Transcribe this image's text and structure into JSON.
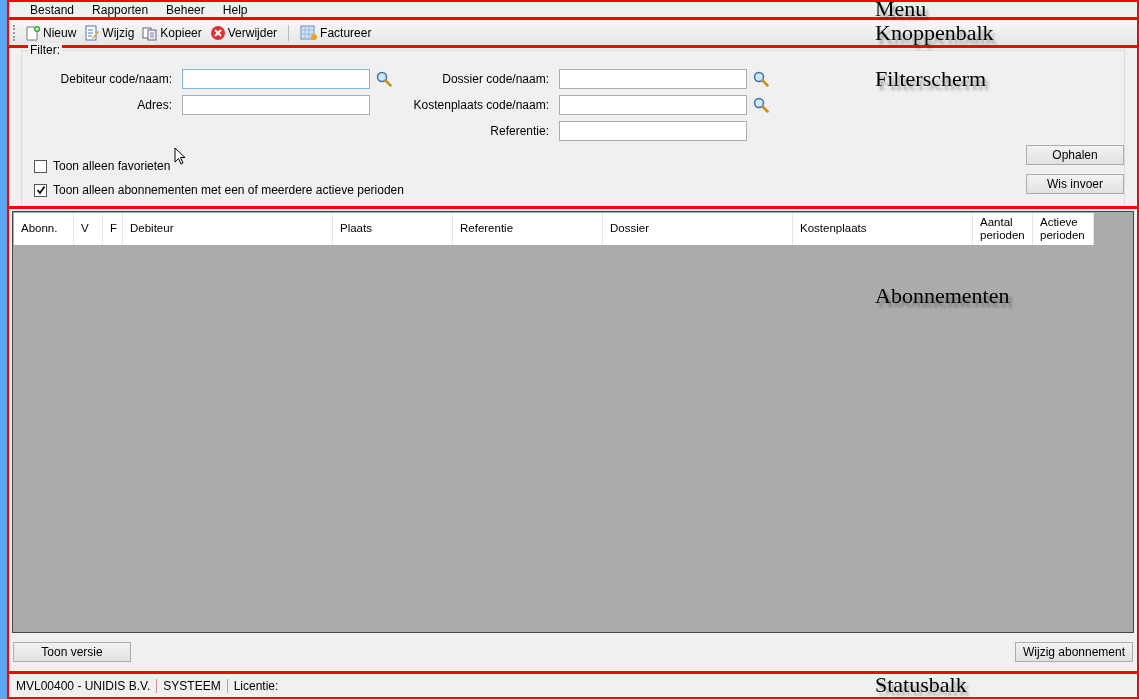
{
  "menu": {
    "items": [
      {
        "label": "Bestand"
      },
      {
        "label": "Rapporten"
      },
      {
        "label": "Beheer"
      },
      {
        "label": "Help"
      }
    ],
    "annotation": "Menu"
  },
  "toolbar": {
    "items": [
      {
        "label": "Nieuw",
        "kind": "new",
        "separator_before": false
      },
      {
        "label": "Wijzig",
        "kind": "edit",
        "separator_before": false
      },
      {
        "label": "Kopieer",
        "kind": "copy",
        "separator_before": false
      },
      {
        "label": "Verwijder",
        "kind": "delete",
        "separator_before": false
      },
      {
        "label": "Factureer",
        "kind": "invoice",
        "separator_before": true
      }
    ],
    "annotation": "Knoppenbalk"
  },
  "filter": {
    "title": "Filter:",
    "annotation": "Filterscherm",
    "left_fields": [
      {
        "label": "Debiteur code/naam:",
        "lookup": true,
        "focused": true
      },
      {
        "label": "Adres:",
        "lookup": false,
        "focused": false
      }
    ],
    "right_fields": [
      {
        "label": "Dossier code/naam:",
        "lookup": true,
        "focused": false
      },
      {
        "label": "Kostenplaats code/naam:",
        "lookup": true,
        "focused": false
      },
      {
        "label": "Referentie:",
        "lookup": false,
        "focused": false
      }
    ],
    "checkboxes": [
      {
        "label": "Toon alleen favorieten",
        "checked": false
      },
      {
        "label": "Toon alleen abonnementen met een of meerdere actieve perioden",
        "checked": true
      }
    ],
    "buttons": [
      "Ophalen",
      "Wis invoer"
    ]
  },
  "subscriptions": {
    "annotation": "Abonnementen",
    "columns": [
      {
        "label": "Abonn."
      },
      {
        "label": "V"
      },
      {
        "label": "F"
      },
      {
        "label": "Debiteur"
      },
      {
        "label": "Plaats"
      },
      {
        "label": "Referentie"
      },
      {
        "label": "Dossier"
      },
      {
        "label": "Kostenplaats"
      },
      {
        "label": "Aantal perioden"
      },
      {
        "label": "Actieve perioden"
      }
    ],
    "buttons": [
      "Toon versie",
      "Wijzig abonnement"
    ]
  },
  "status_bar": {
    "items": [
      "MVL00400 - UNIDIS B.V.",
      "SYSTEEM",
      "Licentie:"
    ],
    "annotation": "Statusbalk"
  }
}
